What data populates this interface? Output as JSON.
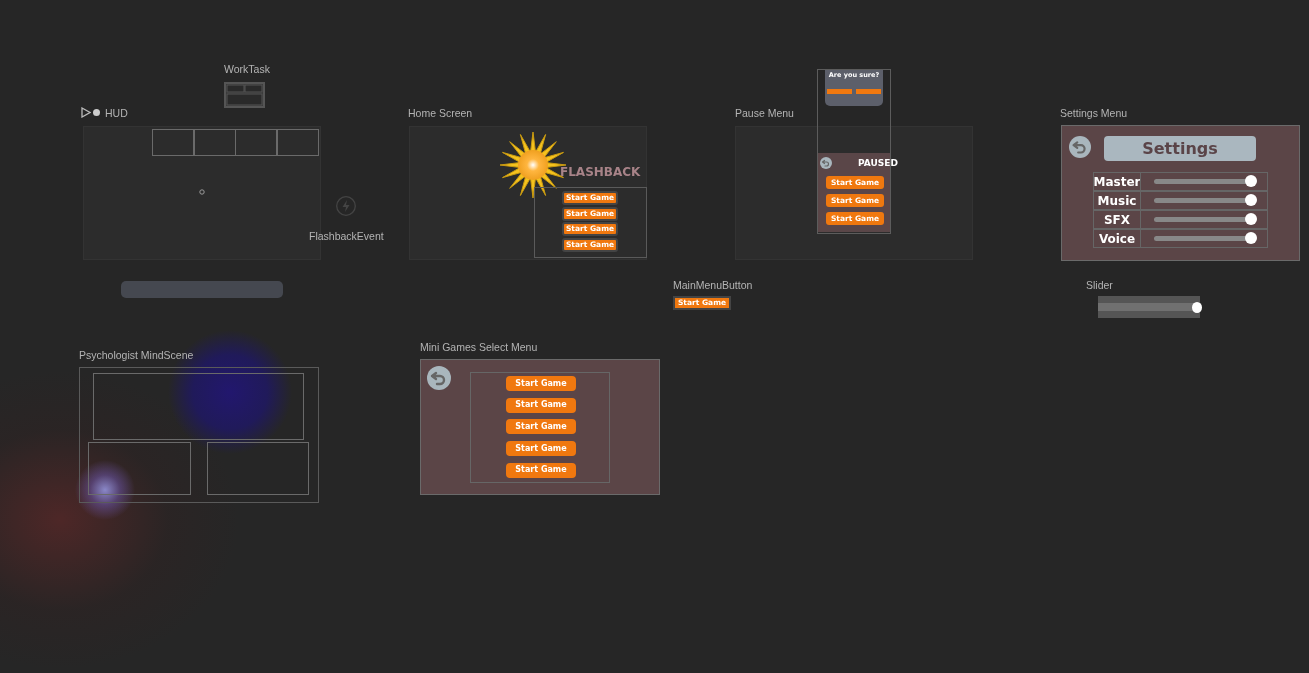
{
  "nodes": [
    {
      "kind": "worktask",
      "label": "WorkTask"
    },
    {
      "kind": "hud",
      "label": "HUD"
    },
    {
      "kind": "event",
      "label": "FlashbackEvent"
    },
    {
      "kind": "home",
      "label": "Home Screen",
      "logo": "FLASHBACK",
      "buttons": [
        "Start Game",
        "Start Game",
        "Start Game",
        "Start Game"
      ]
    },
    {
      "kind": "pause",
      "label": "Pause Menu",
      "dialog_title": "Are you sure?",
      "title": "PAUSED",
      "buttons": [
        "Start Game",
        "Start Game",
        "Start Game"
      ]
    },
    {
      "kind": "settings",
      "label": "Settings Menu",
      "title": "Settings",
      "channels": [
        {
          "name": "Master",
          "level": 0.97
        },
        {
          "name": "Music",
          "level": 0.97
        },
        {
          "name": "SFX",
          "level": 0.97
        },
        {
          "name": "Voice",
          "level": 0.97
        }
      ]
    },
    {
      "kind": "button",
      "label": "MainMenuButton",
      "button": "Start Game"
    },
    {
      "kind": "slider",
      "label": "Slider",
      "level": 0.97
    },
    {
      "kind": "mind",
      "label": "Psychologist MindScene"
    },
    {
      "kind": "minigames",
      "label": "Mini Games Select Menu",
      "buttons": [
        "Start Game",
        "Start Game",
        "Start Game",
        "Start Game",
        "Start Game"
      ]
    }
  ]
}
